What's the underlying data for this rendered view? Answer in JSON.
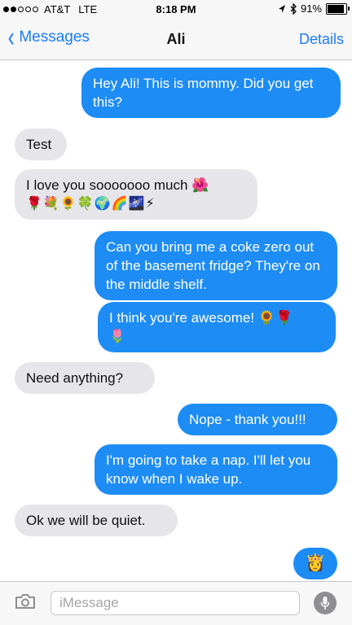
{
  "status_bar": {
    "carrier": "AT&T",
    "network": "LTE",
    "time": "8:18 PM",
    "battery": "91%",
    "battery_level": 0.91,
    "signal_bars_filled": 2,
    "signal_bars_total": 5
  },
  "nav": {
    "back_label": "Messages",
    "title": "Ali",
    "details_label": "Details"
  },
  "messages": [
    {
      "from": "me",
      "text": "Hey Ali! This is mommy. Did you get this?"
    },
    {
      "from": "them",
      "text": "Test"
    },
    {
      "from": "them",
      "text": "I love you sooooooo  much 🌺",
      "emoji_line": "🌹💐🌻🍀🌍🌈🌌⚡"
    },
    {
      "from": "me",
      "text": "Can you bring me a coke zero out of the basement fridge? They're on the middle shelf."
    },
    {
      "from": "me",
      "text": "I think you're awesome! 🌻🌹",
      "emoji_line": "🌷"
    },
    {
      "from": "them",
      "text": "Need anything?"
    },
    {
      "from": "me",
      "text": "Nope - thank you!!!"
    },
    {
      "from": "me",
      "text": "I'm going to take a nap. I'll let you know when I wake up."
    },
    {
      "from": "them",
      "text": "Ok we will be quiet."
    },
    {
      "from": "me",
      "text": "👸"
    }
  ],
  "input": {
    "placeholder": "iMessage"
  },
  "icons": {
    "back": "chevron-left-icon",
    "camera": "camera-icon",
    "mic": "microphone-icon",
    "location": "location-arrow-icon",
    "bluetooth": "bluetooth-icon"
  },
  "colors": {
    "accent": "#1b7cf7",
    "outgoing_bubble": "#1d8cf5",
    "incoming_bubble": "#e5e5ea"
  }
}
